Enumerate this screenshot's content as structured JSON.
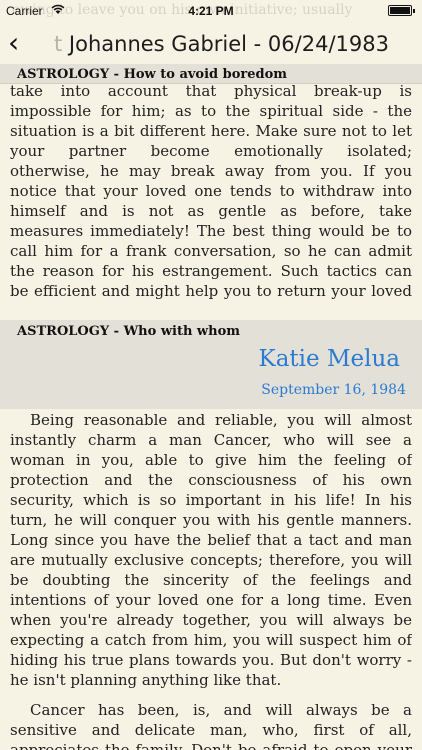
{
  "status_bar": {
    "carrier": "Carrier",
    "time": "4:21 PM"
  },
  "ghost_text": "ewing to leave you on his own initiative; usually",
  "nav": {
    "title_fade": "t ",
    "title": "Johannes Gabriel - 06/24/1983"
  },
  "section1": {
    "header": "ASTROLOGY - How to avoid boredom",
    "text": "take into account that physical break-up is impossible for him; as to the spiritual side - the situation is a bit different here. Make sure not to let your partner become emotionally isolated; otherwise, he may break away from you. If you notice that your loved one tends to withdraw into himself and is not as gentle as before, take measures immediately! The best thing would be to call him for a frank conversation, so he can admit the reason for his estrangement. Such tactics can be efficient and might help you to return your loved one..."
  },
  "section2": {
    "header": "ASTROLOGY - Who with whom",
    "author": "Katie Melua",
    "date": "September 16, 1984",
    "paragraphs": [
      "Being reasonable and reliable, you will almost instantly charm a man Cancer, who will see a woman in you, able to give him the feeling of protection and the consciousness of his own security, which is so important in his life! In his turn, he will conquer you with his gentle manners. Long since you have the belief that a tact and man are mutually exclusive concepts; therefore, you will be doubting the sincerity of the feelings and intentions of your loved one for a long time. Even when you're already together, you will always be expecting a catch from him, you will suspect him of hiding his true plans towards you. But don't worry - he isn't planning anything like that.",
      "Cancer has been, is, and will always be a sensitive and delicate man, who, first of all, appreciates the family. Don't be afraid to open your feelings to him - he's not one of those who would"
    ]
  }
}
